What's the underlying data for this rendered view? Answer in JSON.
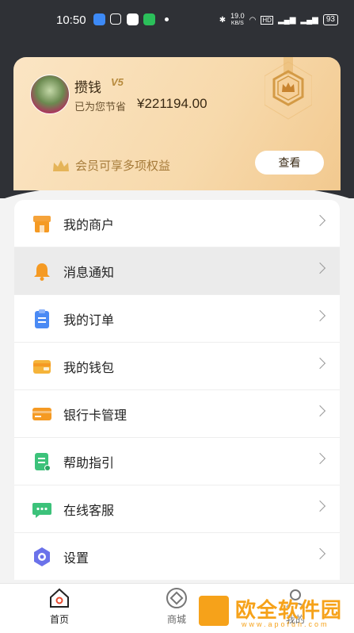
{
  "status_bar": {
    "time": "10:50",
    "network_speed": "19.0",
    "speed_unit": "KB/S",
    "battery": "93"
  },
  "vip_card": {
    "username": "攒钱",
    "vip_level": "V5",
    "saved_label": "已为您节省",
    "saved_amount": "¥221194.00",
    "benefits_text": "会员可享多项权益",
    "view_button": "查看"
  },
  "menu": {
    "items": [
      {
        "label": "我的商户",
        "icon": "shop-icon",
        "color": "#f59a23"
      },
      {
        "label": "消息通知",
        "icon": "bell-icon",
        "color": "#f59a23"
      },
      {
        "label": "我的订单",
        "icon": "clipboard-icon",
        "color": "#4a8af4"
      },
      {
        "label": "我的钱包",
        "icon": "wallet-icon",
        "color": "#f5b43a"
      },
      {
        "label": "银行卡管理",
        "icon": "bank-card-icon",
        "color": "#f59a23"
      },
      {
        "label": "帮助指引",
        "icon": "help-doc-icon",
        "color": "#3cc27a"
      },
      {
        "label": "在线客服",
        "icon": "chat-icon",
        "color": "#3cc27a"
      },
      {
        "label": "设置",
        "icon": "settings-icon",
        "color": "#6b72ea"
      }
    ]
  },
  "tabbar": {
    "home": "首页",
    "mall": "商城",
    "mine": "我的"
  },
  "watermark": {
    "brand": "欧全软件园",
    "url": "www.apofun.com"
  }
}
